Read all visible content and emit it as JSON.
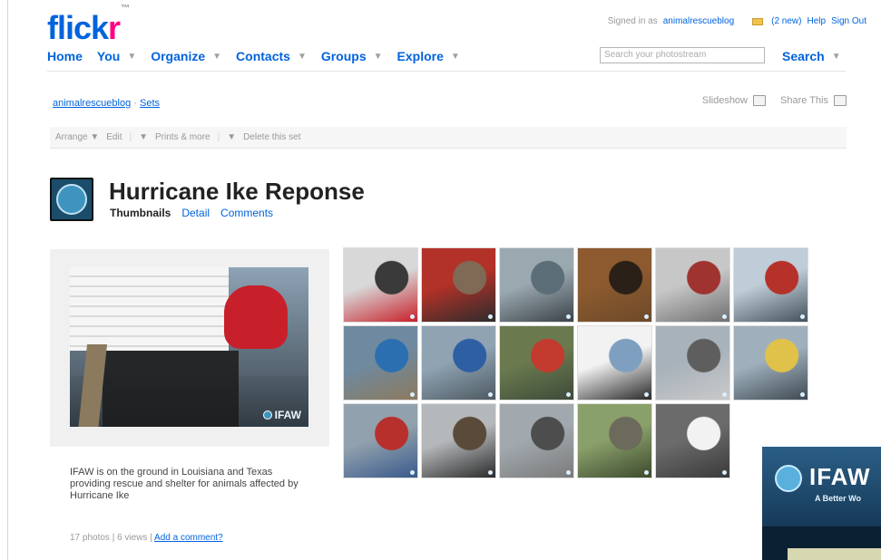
{
  "brand": {
    "logo_blue": "flick",
    "logo_pink": "r",
    "logo_mark": "™"
  },
  "userbar": {
    "signed_in_prefix": "Signed in as",
    "username": "animalrescueblog",
    "mail": "(2 new)",
    "help": "Help",
    "signout": "Sign Out"
  },
  "nav": {
    "items": [
      {
        "label": "Home",
        "arrow": ""
      },
      {
        "label": "You",
        "arrow": "▼"
      },
      {
        "label": "Organize",
        "arrow": "▼"
      },
      {
        "label": "Contacts",
        "arrow": "▼"
      },
      {
        "label": "Groups",
        "arrow": "▼"
      },
      {
        "label": "Explore",
        "arrow": "▼"
      }
    ],
    "search_placeholder": "Search your photostream",
    "search_label": "Search",
    "search_arrow": "▼"
  },
  "breadcrumb": {
    "user": "animalrescueblog",
    "sep": "·",
    "sets": "Sets"
  },
  "share": {
    "slideshow": "Slideshow",
    "share_this": "Share This"
  },
  "toolbar": {
    "arrange": "Arrange ▼",
    "edit": "Edit",
    "edit_arrow": "▼",
    "prints": "Prints & more",
    "prints_arrow": "▼",
    "delete": "Delete this set"
  },
  "set": {
    "title": "Hurricane Ike Reponse",
    "tabs": {
      "thumbnails": "Thumbnails",
      "detail": "Detail",
      "comments": "Comments"
    }
  },
  "primary": {
    "watermark": "IFAW",
    "description": "IFAW is on the ground in Louisiana and Texas providing rescue and shelter for animals affected by Hurricane Ike",
    "meta_prefix": "17 photos | 6 views |",
    "add_comment": "Add a comment?"
  },
  "overlay": {
    "brand": "IFAW",
    "tagline": "A Better Wo"
  },
  "thumbnails": [
    {
      "colors": [
        "#d8d8d8",
        "#3a3a3a",
        "#c8202a"
      ]
    },
    {
      "colors": [
        "#b23128",
        "#7e6a55",
        "#2c2c2c"
      ]
    },
    {
      "colors": [
        "#9aa8b0",
        "#5b6d77",
        "#3b4248"
      ]
    },
    {
      "colors": [
        "#8c5a2e",
        "#2a2018",
        "#6d4a2a"
      ]
    },
    {
      "colors": [
        "#c7c7c7",
        "#9f3330",
        "#6f6f6f"
      ]
    },
    {
      "colors": [
        "#bfcdd8",
        "#b5312a",
        "#44525c"
      ]
    },
    {
      "colors": [
        "#6f8aa0",
        "#2c6fb0",
        "#8b7a5e"
      ]
    },
    {
      "colors": [
        "#8fa3b3",
        "#2e5fa3",
        "#4e5a62"
      ]
    },
    {
      "colors": [
        "#6a7a4e",
        "#c33a2e",
        "#3e4a3a"
      ]
    },
    {
      "colors": [
        "#f2f2f2",
        "#7f9fc1",
        "#2a2a2a"
      ]
    },
    {
      "colors": [
        "#a8b2ba",
        "#5e5e5e",
        "#c9c9c9"
      ]
    },
    {
      "colors": [
        "#9fb0bc",
        "#e0c24a",
        "#3e4a52"
      ]
    },
    {
      "colors": [
        "#91a1ad",
        "#b8302b",
        "#3a5a8c"
      ]
    },
    {
      "colors": [
        "#b5b8bb",
        "#5a4a3a",
        "#2b2b2b"
      ]
    },
    {
      "colors": [
        "#a1a9ae",
        "#4d4d4d",
        "#7a7a7a"
      ]
    },
    {
      "colors": [
        "#8aa06a",
        "#6c6a5a",
        "#3d4a2e"
      ]
    },
    {
      "colors": [
        "#6b6b6b",
        "#f2f2f2",
        "#3a3a3a"
      ]
    }
  ]
}
